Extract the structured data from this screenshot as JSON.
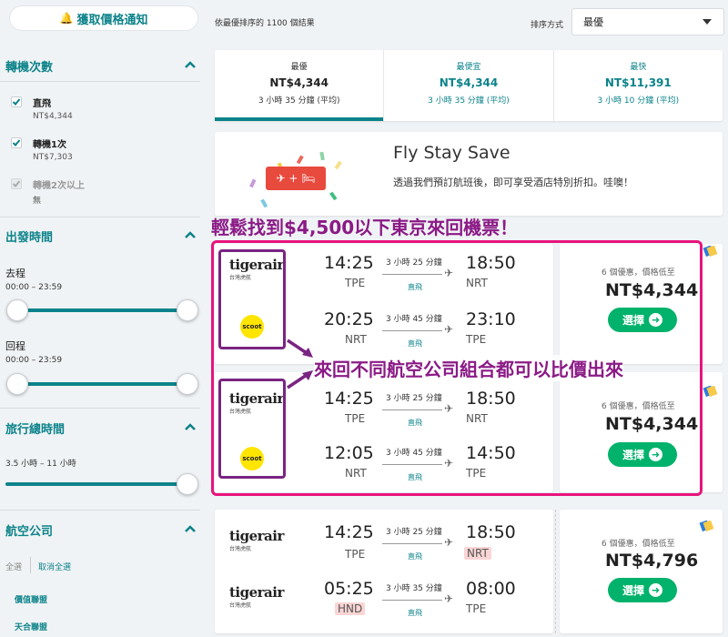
{
  "sidebar": {
    "alert_button": "獲取價格通知",
    "stops": {
      "title": "轉機次數",
      "options": [
        {
          "label": "直飛",
          "price": "NT$4,344"
        },
        {
          "label": "轉機1次",
          "price": "NT$7,303"
        },
        {
          "label": "轉機2次以上",
          "price": "無"
        }
      ]
    },
    "departure": {
      "title": "出發時間",
      "outbound_label": "去程",
      "outbound_range": "00:00 – 23:59",
      "return_label": "回程",
      "return_range": "00:00 – 23:59"
    },
    "duration": {
      "title": "旅行總時間",
      "range": "3.5 小時 – 11 小時"
    },
    "airlines": {
      "title": "航空公司",
      "select_all": "全選",
      "clear_all": "取消全選",
      "items": [
        "價值聯盟",
        "天合聯盟"
      ]
    }
  },
  "results": {
    "count_text": "依最優排序的 1100 個結果",
    "sort_label": "排序方式",
    "sort_value": "最優"
  },
  "sort_tabs": [
    {
      "name": "最優",
      "price": "NT$4,344",
      "duration": "3 小時 35 分鐘 (平均)"
    },
    {
      "name": "最便宜",
      "price": "NT$4,344",
      "duration": "3 小時 35 分鐘 (平均)"
    },
    {
      "name": "最快",
      "price": "NT$11,391",
      "duration": "3 小時 10 分鐘 (平均)"
    }
  ],
  "promo": {
    "title": "Fly Stay Save",
    "description": "透過我們預訂航班後，即可享受酒店特別折扣。哇噢！",
    "icon_text": "✈ + 🛏"
  },
  "annotations": {
    "headline": "輕鬆找到$4,500以下東京來回機票！",
    "callout": "來回不同航空公司組合都可以比價出來"
  },
  "flights": [
    {
      "legs": [
        {
          "airline": "tigerair",
          "airline_sub": "台灣虎航",
          "dep_time": "14:25",
          "dep_code": "TPE",
          "duration": "3 小時 25 分鐘",
          "stops": "直飛",
          "arr_time": "18:50",
          "arr_code": "NRT"
        },
        {
          "airline": "scoot",
          "airline_sub": "",
          "dep_time": "20:25",
          "dep_code": "NRT",
          "duration": "3 小時 45 分鐘",
          "stops": "直飛",
          "arr_time": "23:10",
          "arr_code": "TPE"
        }
      ],
      "deals": "6 個優惠，價格低至",
      "price": "NT$4,344",
      "select_label": "選擇"
    },
    {
      "legs": [
        {
          "airline": "tigerair",
          "airline_sub": "台灣虎航",
          "dep_time": "14:25",
          "dep_code": "TPE",
          "duration": "3 小時 25 分鐘",
          "stops": "直飛",
          "arr_time": "18:50",
          "arr_code": "NRT"
        },
        {
          "airline": "scoot",
          "airline_sub": "",
          "dep_time": "12:05",
          "dep_code": "NRT",
          "duration": "3 小時 45 分鐘",
          "stops": "直飛",
          "arr_time": "14:50",
          "arr_code": "TPE"
        }
      ],
      "deals": "6 個優惠，價格低至",
      "price": "NT$4,344",
      "select_label": "選擇"
    },
    {
      "legs": [
        {
          "airline": "tigerair",
          "airline_sub": "台灣虎航",
          "dep_time": "14:25",
          "dep_code": "TPE",
          "duration": "3 小時 25 分鐘",
          "stops": "直飛",
          "arr_time": "18:50",
          "arr_code": "NRT"
        },
        {
          "airline": "tigerair",
          "airline_sub": "台灣虎航",
          "dep_time": "05:25",
          "dep_code": "HND",
          "duration": "3 小時 35 分鐘",
          "stops": "直飛",
          "arr_time": "08:00",
          "arr_code": "TPE"
        }
      ],
      "deals": "6 個優惠，價格低至",
      "price": "NT$4,796",
      "select_label": "選擇"
    }
  ],
  "colors": {
    "accent": "#0c838a",
    "select_button": "#00b26b",
    "annotation_text": "#8b1a86",
    "annotation_box": "#e8147d",
    "airport_highlight": "#fbd5d5"
  }
}
